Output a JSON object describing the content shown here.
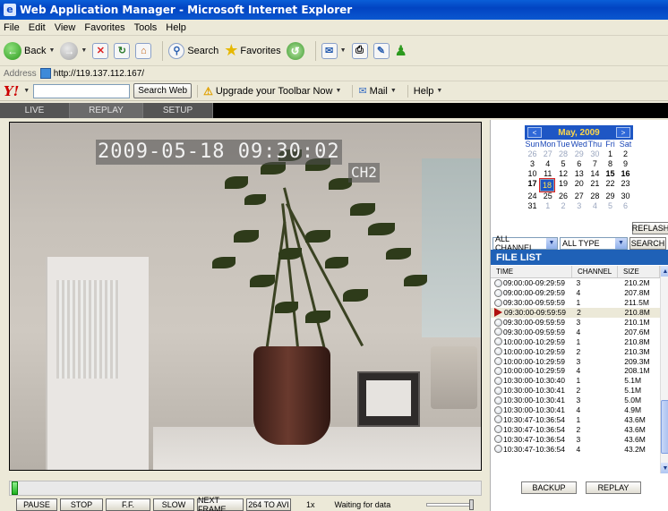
{
  "window": {
    "title": "Web Application Manager - Microsoft Internet Explorer"
  },
  "menu": [
    "File",
    "Edit",
    "View",
    "Favorites",
    "Tools",
    "Help"
  ],
  "toolbar": {
    "back": "Back",
    "search": "Search",
    "favorites": "Favorites"
  },
  "address": {
    "label": "Address",
    "url": "http://119.137.112.167/"
  },
  "yahoo": {
    "logo": "Y!",
    "search_button": "Search Web",
    "upgrade": "Upgrade your Toolbar Now",
    "mail": "Mail",
    "help": "Help"
  },
  "nav": {
    "live": "LIVE",
    "replay": "REPLAY",
    "setup": "SETUP"
  },
  "video": {
    "timestamp": "2009-05-18 09:30:02",
    "channel": "CH2"
  },
  "controls": {
    "pause": "PAUSE",
    "stop": "STOP",
    "ff": "F.F.",
    "slow": "SLOW",
    "next_frame": "NEXT FRAME",
    "to_avi": "264 TO AVI",
    "speed": "1x",
    "status": "Waiting for data"
  },
  "calendar": {
    "title": "May, 2009",
    "prev": "<",
    "next": ">",
    "dow": [
      "Sun",
      "Mon",
      "Tue",
      "Wed",
      "Thu",
      "Fri",
      "Sat"
    ],
    "weeks": [
      [
        "26",
        "27",
        "28",
        "29",
        "30",
        "1",
        "2"
      ],
      [
        "3",
        "4",
        "5",
        "6",
        "7",
        "8",
        "9"
      ],
      [
        "10",
        "11",
        "12",
        "13",
        "14",
        "15",
        "16"
      ],
      [
        "17",
        "18",
        "19",
        "20",
        "21",
        "22",
        "23"
      ],
      [
        "24",
        "25",
        "26",
        "27",
        "28",
        "29",
        "30"
      ],
      [
        "31",
        "1",
        "2",
        "3",
        "4",
        "5",
        "6"
      ]
    ]
  },
  "refresh": "REFLASH",
  "filters": {
    "channel": "ALL CHANNEL",
    "type": "ALL TYPE",
    "search": "SEARCH"
  },
  "filelist": {
    "title": "FILE LIST",
    "columns": [
      "TIME",
      "CHANNEL",
      "SIZE"
    ],
    "rows": [
      {
        "time": "09:00:00-09:29:59",
        "channel": "3",
        "size": "210.2M"
      },
      {
        "time": "09:00:00-09:29:59",
        "channel": "4",
        "size": "207.8M"
      },
      {
        "time": "09:30:00-09:59:59",
        "channel": "1",
        "size": "211.5M"
      },
      {
        "time": "09:30:00-09:59:59",
        "channel": "2",
        "size": "210.8M"
      },
      {
        "time": "09:30:00-09:59:59",
        "channel": "3",
        "size": "210.1M"
      },
      {
        "time": "09:30:00-09:59:59",
        "channel": "4",
        "size": "207.6M"
      },
      {
        "time": "10:00:00-10:29:59",
        "channel": "1",
        "size": "210.8M"
      },
      {
        "time": "10:00:00-10:29:59",
        "channel": "2",
        "size": "210.3M"
      },
      {
        "time": "10:00:00-10:29:59",
        "channel": "3",
        "size": "209.3M"
      },
      {
        "time": "10:00:00-10:29:59",
        "channel": "4",
        "size": "208.1M"
      },
      {
        "time": "10:30:00-10:30:40",
        "channel": "1",
        "size": "5.1M"
      },
      {
        "time": "10:30:00-10:30:41",
        "channel": "2",
        "size": "5.1M"
      },
      {
        "time": "10:30:00-10:30:41",
        "channel": "3",
        "size": "5.0M"
      },
      {
        "time": "10:30:00-10:30:41",
        "channel": "4",
        "size": "4.9M"
      },
      {
        "time": "10:30:47-10:36:54",
        "channel": "1",
        "size": "43.6M"
      },
      {
        "time": "10:30:47-10:36:54",
        "channel": "2",
        "size": "43.6M"
      },
      {
        "time": "10:30:47-10:36:54",
        "channel": "3",
        "size": "43.6M"
      },
      {
        "time": "10:30:47-10:36:54",
        "channel": "4",
        "size": "43.2M"
      }
    ]
  },
  "actions": {
    "backup": "BACKUP",
    "replay": "REPLAY"
  }
}
